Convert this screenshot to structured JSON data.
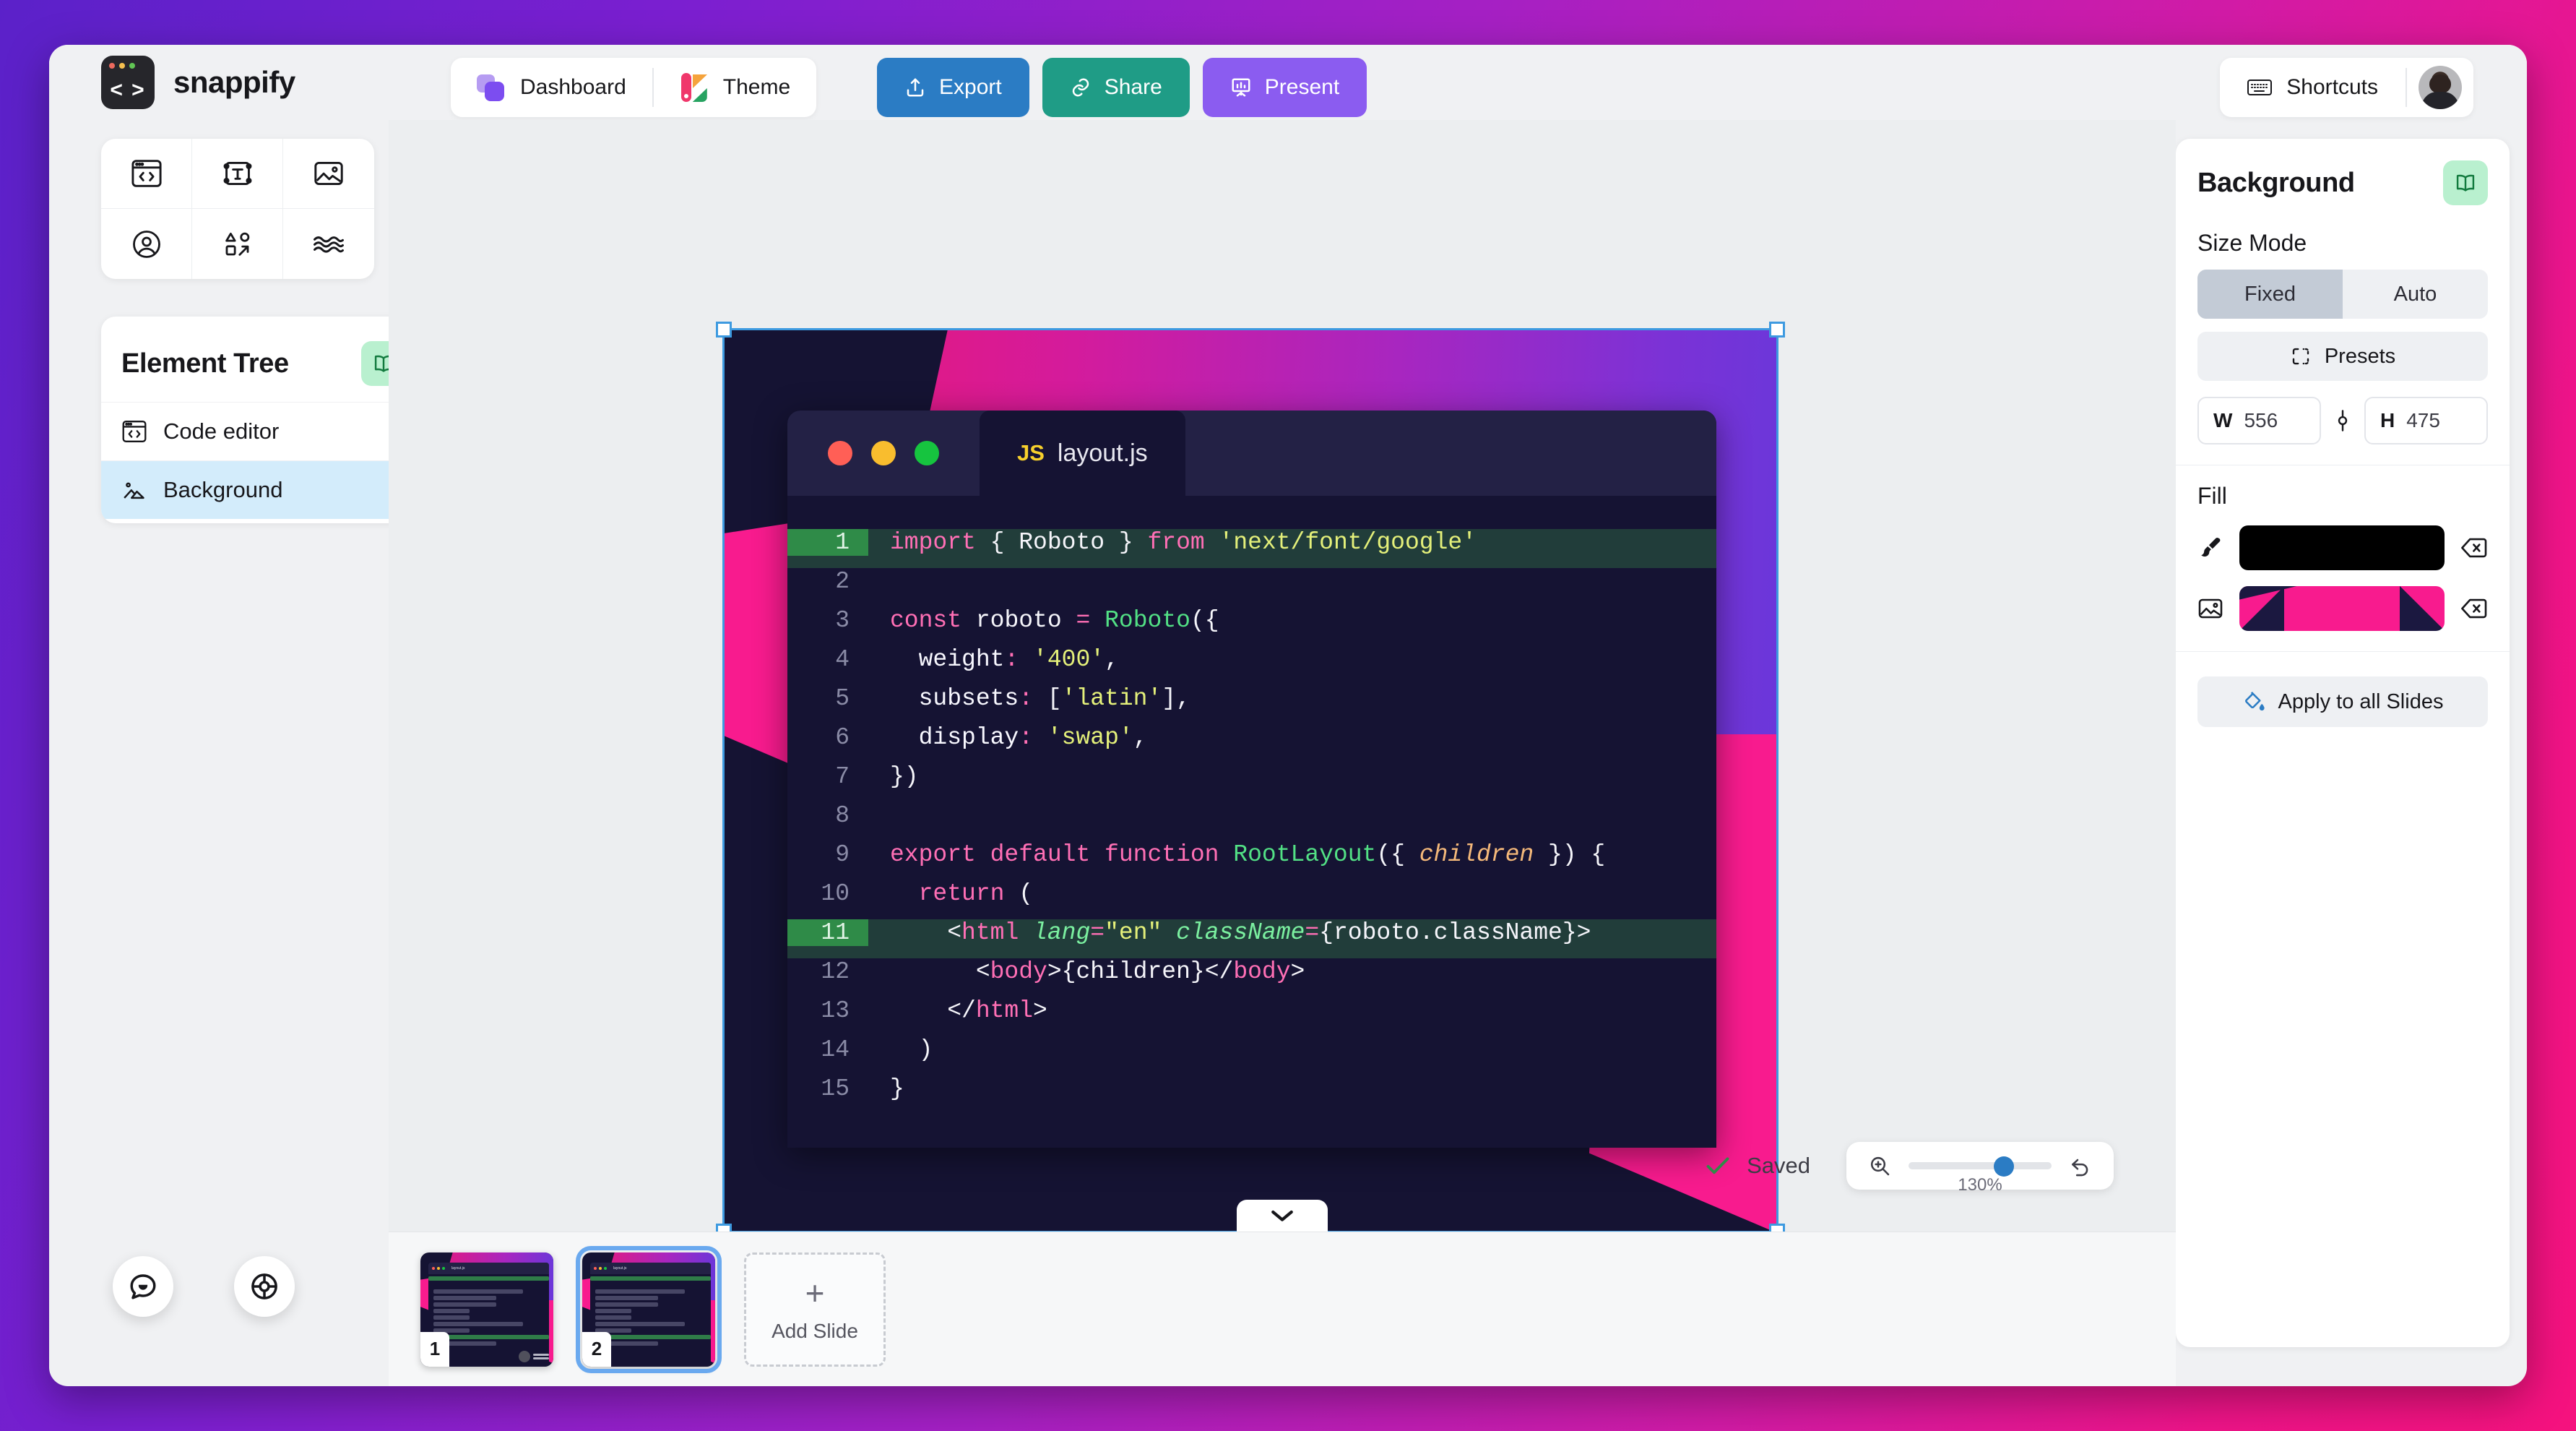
{
  "app": {
    "brand_name": "snappify",
    "logo_glyph": "< >"
  },
  "header": {
    "nav": [
      {
        "label": "Dashboard",
        "icon": "dashboard-icon"
      },
      {
        "label": "Theme",
        "icon": "theme-palette-icon"
      }
    ],
    "actions": [
      {
        "label": "Export",
        "icon": "export-upload-icon",
        "color": "#2b7cc4"
      },
      {
        "label": "Share",
        "icon": "link-chain-icon",
        "color": "#1f9c86"
      },
      {
        "label": "Present",
        "icon": "presentation-screen-icon",
        "color": "#8b5cf0"
      }
    ],
    "shortcuts_label": "Shortcuts",
    "shortcuts_icon": "keyboard-icon",
    "avatar_icon": "user-avatar"
  },
  "left_rail": {
    "tools": [
      {
        "name": "code-editor-tool",
        "icon": "code-window-icon"
      },
      {
        "name": "text-tool",
        "icon": "text-box-icon"
      },
      {
        "name": "image-tool",
        "icon": "image-icon"
      },
      {
        "name": "avatar-tool",
        "icon": "user-circle-icon"
      },
      {
        "name": "shapes-tool",
        "icon": "shapes-arrow-icon"
      },
      {
        "name": "wave-tool",
        "icon": "waves-icon"
      }
    ],
    "element_tree": {
      "title": "Element Tree",
      "badge_icon": "book-open-icon",
      "items": [
        {
          "label": "Code editor",
          "icon": "code-window-icon",
          "selected": false
        },
        {
          "label": "Background",
          "icon": "image-mountain-icon",
          "selected": true
        }
      ]
    }
  },
  "canvas": {
    "code_window": {
      "tab_language": "JS",
      "tab_filename": "layout.js",
      "traffic_lights": [
        "#ff5f56",
        "#f9bd2e",
        "#16c43f"
      ],
      "lines": [
        {
          "n": "1",
          "highlight": true,
          "tokens": [
            [
              "kw",
              "import"
            ],
            [
              "pun",
              " { "
            ],
            [
              "var",
              "Roboto"
            ],
            [
              "pun",
              " } "
            ],
            [
              "kw",
              "from"
            ],
            [
              "pun",
              " "
            ],
            [
              "str",
              "'next/font/google'"
            ]
          ]
        },
        {
          "n": "2",
          "highlight": false,
          "tokens": []
        },
        {
          "n": "3",
          "highlight": false,
          "tokens": [
            [
              "kw",
              "const"
            ],
            [
              "pun",
              " "
            ],
            [
              "var",
              "roboto"
            ],
            [
              "pun",
              " "
            ],
            [
              "kw",
              "="
            ],
            [
              "pun",
              " "
            ],
            [
              "fn",
              "Roboto"
            ],
            [
              "pun",
              "({"
            ]
          ]
        },
        {
          "n": "4",
          "highlight": false,
          "tokens": [
            [
              "pun",
              "  "
            ],
            [
              "prop",
              "weight"
            ],
            [
              "kw",
              ":"
            ],
            [
              "pun",
              " "
            ],
            [
              "str",
              "'400'"
            ],
            [
              "pun",
              ","
            ]
          ]
        },
        {
          "n": "5",
          "highlight": false,
          "tokens": [
            [
              "pun",
              "  "
            ],
            [
              "prop",
              "subsets"
            ],
            [
              "kw",
              ":"
            ],
            [
              "pun",
              " ["
            ],
            [
              "str",
              "'latin'"
            ],
            [
              "pun",
              "],"
            ]
          ]
        },
        {
          "n": "6",
          "highlight": false,
          "tokens": [
            [
              "pun",
              "  "
            ],
            [
              "prop",
              "display"
            ],
            [
              "kw",
              ":"
            ],
            [
              "pun",
              " "
            ],
            [
              "str",
              "'swap'"
            ],
            [
              "pun",
              ","
            ]
          ]
        },
        {
          "n": "7",
          "highlight": false,
          "tokens": [
            [
              "pun",
              "})"
            ]
          ]
        },
        {
          "n": "8",
          "highlight": false,
          "tokens": []
        },
        {
          "n": "9",
          "highlight": false,
          "tokens": [
            [
              "kw",
              "export default function"
            ],
            [
              "pun",
              " "
            ],
            [
              "fn",
              "RootLayout"
            ],
            [
              "pun",
              "({ "
            ],
            [
              "param",
              "children"
            ],
            [
              "pun",
              " }) {"
            ]
          ]
        },
        {
          "n": "10",
          "highlight": false,
          "tokens": [
            [
              "pun",
              "  "
            ],
            [
              "kw",
              "return"
            ],
            [
              "pun",
              " ("
            ]
          ]
        },
        {
          "n": "11",
          "highlight": true,
          "tokens": [
            [
              "pun",
              "    <"
            ],
            [
              "tag",
              "html"
            ],
            [
              "pun",
              " "
            ],
            [
              "attr",
              "lang"
            ],
            [
              "kw",
              "="
            ],
            [
              "str",
              "\"en\""
            ],
            [
              "pun",
              " "
            ],
            [
              "attr",
              "className"
            ],
            [
              "kw",
              "="
            ],
            [
              "pun",
              "{"
            ],
            [
              "var",
              "roboto.className"
            ],
            [
              "pun",
              "}>"
            ]
          ]
        },
        {
          "n": "12",
          "highlight": false,
          "tokens": [
            [
              "pun",
              "      <"
            ],
            [
              "tag",
              "body"
            ],
            [
              "pun",
              ">{"
            ],
            [
              "var",
              "children"
            ],
            [
              "pun",
              "}</"
            ],
            [
              "tag",
              "body"
            ],
            [
              "pun",
              ">"
            ]
          ]
        },
        {
          "n": "13",
          "highlight": false,
          "tokens": [
            [
              "pun",
              "    </"
            ],
            [
              "tag",
              "html"
            ],
            [
              "pun",
              ">"
            ]
          ]
        },
        {
          "n": "14",
          "highlight": false,
          "tokens": [
            [
              "pun",
              "  )"
            ]
          ]
        },
        {
          "n": "15",
          "highlight": false,
          "tokens": [
            [
              "pun",
              "}"
            ]
          ]
        }
      ]
    },
    "status": {
      "saved_label": "Saved",
      "saved_icon": "check-icon",
      "zoom_icon": "magnifier-plus-icon",
      "zoom_value": "130%",
      "reset_icon": "undo-arrow-icon"
    },
    "collapse_icon": "chevron-down-icon"
  },
  "filmstrip": {
    "slides": [
      {
        "number": "1",
        "active": false
      },
      {
        "number": "2",
        "active": true
      }
    ],
    "add_slide_label": "Add Slide",
    "add_slide_plus": "+"
  },
  "fabs": [
    {
      "name": "feedback-chat-button",
      "icon": "chat-bubble-icon"
    },
    {
      "name": "help-button",
      "icon": "lifebuoy-icon"
    }
  ],
  "right_panel": {
    "title": "Background",
    "badge_icon": "book-open-icon",
    "size_mode_label": "Size Mode",
    "size_modes": [
      {
        "label": "Fixed",
        "selected": true
      },
      {
        "label": "Auto",
        "selected": false
      }
    ],
    "presets_label": "Presets",
    "presets_icon": "presets-frame-icon",
    "width_key": "W",
    "width_value": "556",
    "link_icon": "link-dimensions-icon",
    "height_key": "H",
    "height_value": "475",
    "fill_label": "Fill",
    "fill_rows": [
      {
        "icon": "brush-icon",
        "type": "solid",
        "color": "#000000",
        "clear_icon": "clear-x-icon"
      },
      {
        "icon": "image-icon",
        "type": "image",
        "color": "#f81b8e",
        "clear_icon": "clear-x-icon"
      }
    ],
    "apply_label": "Apply to all Slides",
    "apply_icon": "paint-bucket-icon"
  },
  "colors": {
    "page_gradient_from": "#5b21c9",
    "page_gradient_to": "#f5127e",
    "accent_blue": "#2b7cc4",
    "accent_teal": "#1f9c86",
    "accent_purple": "#8b5cf0",
    "selection": "#3d9ae0",
    "slide_dark": "#151333",
    "slide_pink": "#f81b8e"
  }
}
